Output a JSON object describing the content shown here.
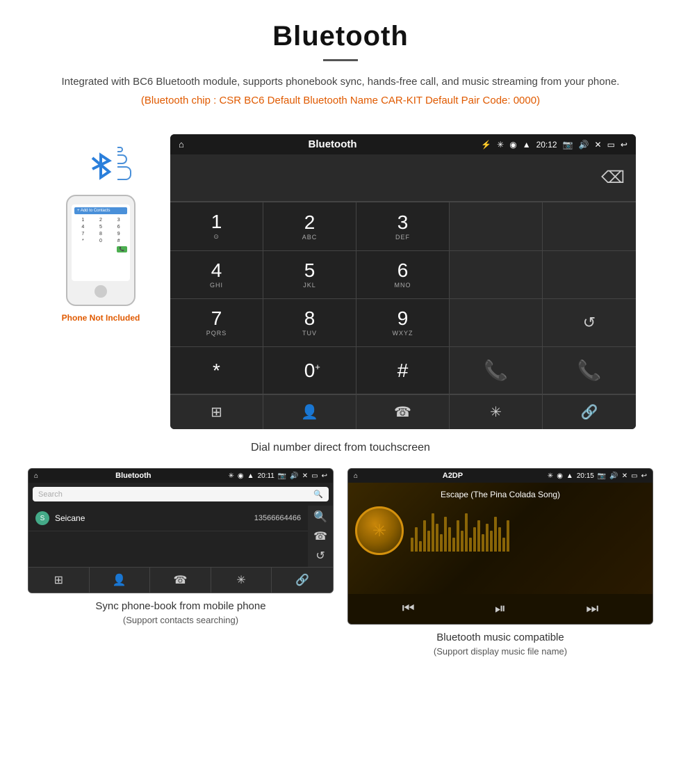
{
  "header": {
    "title": "Bluetooth",
    "subtitle": "Integrated with BC6 Bluetooth module, supports phonebook sync, hands-free call, and music streaming from your phone.",
    "specs": "(Bluetooth chip : CSR BC6    Default Bluetooth Name CAR-KIT    Default Pair Code: 0000)"
  },
  "phone_mockup": {
    "not_included": "Phone Not Included",
    "add_contact": "+ Add to Contacts",
    "dialpad": [
      "1",
      "2",
      "3",
      "4",
      "5",
      "6",
      "7",
      "8",
      "9",
      "*",
      "0",
      "#"
    ]
  },
  "car_screen": {
    "status_bar": {
      "home_icon": "⌂",
      "title": "Bluetooth",
      "usb_icon": "⚡",
      "bt_icon": "✳",
      "location_icon": "◉",
      "signal_icon": "▲",
      "time": "20:12",
      "camera_icon": "📷",
      "volume_icon": "🔊",
      "close_icon": "✕",
      "screen_icon": "▭",
      "back_icon": "↩"
    },
    "dialpad": {
      "rows": [
        [
          {
            "number": "1",
            "sub": ""
          },
          {
            "number": "2",
            "sub": "ABC"
          },
          {
            "number": "3",
            "sub": "DEF"
          },
          {
            "number": "",
            "sub": ""
          },
          {
            "number": "⌫",
            "sub": ""
          }
        ],
        [
          {
            "number": "4",
            "sub": "GHI"
          },
          {
            "number": "5",
            "sub": "JKL"
          },
          {
            "number": "6",
            "sub": "MNO"
          },
          {
            "number": "",
            "sub": ""
          },
          {
            "number": "",
            "sub": ""
          }
        ],
        [
          {
            "number": "7",
            "sub": "PQRS"
          },
          {
            "number": "8",
            "sub": "TUV"
          },
          {
            "number": "9",
            "sub": "WXYZ"
          },
          {
            "number": "",
            "sub": ""
          },
          {
            "number": "↺",
            "sub": ""
          }
        ],
        [
          {
            "number": "*",
            "sub": ""
          },
          {
            "number": "0",
            "sup": "+"
          },
          {
            "number": "#",
            "sub": ""
          },
          {
            "number": "📞",
            "sub": "green"
          },
          {
            "number": "📞",
            "sub": "red"
          }
        ]
      ],
      "bottom_nav": [
        "⊞",
        "👤",
        "☎",
        "✳",
        "🔗"
      ]
    }
  },
  "dial_caption": "Dial number direct from touchscreen",
  "phonebook_screen": {
    "status_title": "Bluetooth",
    "status_time": "20:11",
    "search_placeholder": "Search",
    "contact_letter": "S",
    "contact_name": "Seicane",
    "contact_number": "13566664466",
    "bottom_nav": [
      "⊞",
      "👤",
      "☎",
      "✳",
      "🔗"
    ]
  },
  "music_screen": {
    "status_title": "A2DP",
    "status_time": "20:15",
    "track_name": "Escape (The Pina Colada Song)",
    "bt_icon": "✳",
    "controls": {
      "prev": "⏮",
      "play_pause": "⏯",
      "next": "⏭"
    }
  },
  "captions": {
    "phonebook": "Sync phone-book from mobile phone",
    "phonebook_sub": "(Support contacts searching)",
    "music": "Bluetooth music compatible",
    "music_sub": "(Support display music file name)"
  },
  "viz_bars": [
    20,
    35,
    15,
    45,
    30,
    55,
    40,
    25,
    50,
    35,
    20,
    45,
    30,
    55,
    20,
    35,
    45,
    25,
    40,
    30,
    50,
    35,
    20,
    45
  ]
}
